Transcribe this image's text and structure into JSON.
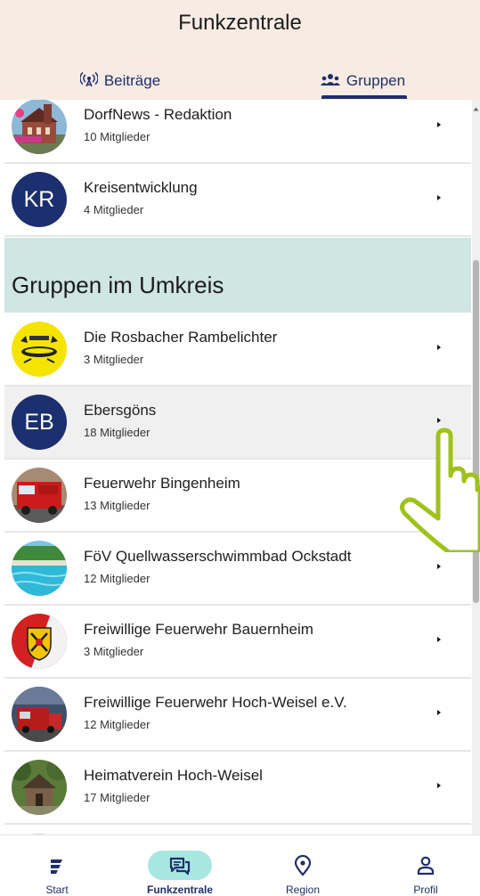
{
  "header": {
    "title": "Funkzentrale",
    "tabs": [
      {
        "label": "Beiträge",
        "icon": "broadcast-icon"
      },
      {
        "label": "Gruppen",
        "icon": "people-icon",
        "selected": true
      }
    ]
  },
  "my_groups": [
    {
      "name": "DorfNews - Redaktion",
      "members": "10 Mitglieder",
      "avatar": "church-photo"
    },
    {
      "name": "Kreisentwicklung",
      "members": "4 Mitglieder",
      "initials": "KR"
    }
  ],
  "nearby": {
    "title": "Gruppen im Umkreis",
    "groups": [
      {
        "name": "Die Rosbacher Rambelichter",
        "members": "3 Mitglieder",
        "avatar": "yellow-logo"
      },
      {
        "name": "Ebersgöns",
        "members": "18 Mitglieder",
        "initials": "EB",
        "highlighted": true
      },
      {
        "name": "Feuerwehr Bingenheim",
        "members": "13 Mitglieder",
        "avatar": "fire-truck-photo"
      },
      {
        "name": "FöV Quellwasserschwimmbad Ockstadt",
        "members": "12 Mitglieder",
        "avatar": "pool-photo"
      },
      {
        "name": "Freiwillige Feuerwehr Bauernheim",
        "members": "3 Mitglieder",
        "avatar": "fire-crest-logo"
      },
      {
        "name": "Freiwillige Feuerwehr Hoch-Weisel e.V.",
        "members": "12 Mitglieder",
        "avatar": "fire-station-photo"
      },
      {
        "name": "Heimatverein Hoch-Weisel",
        "members": "17 Mitglieder",
        "avatar": "hut-photo"
      }
    ]
  },
  "bottom_nav": [
    {
      "label": "Start",
      "icon": "start-icon"
    },
    {
      "label": "Funkzentrale",
      "icon": "chat-icon",
      "active": true
    },
    {
      "label": "Region",
      "icon": "location-pin-icon"
    },
    {
      "label": "Profil",
      "icon": "person-icon"
    }
  ],
  "colors": {
    "header_bg": "#f7ebe3",
    "accent_navy": "#1f2f6a",
    "section_bg": "#cfe6e2",
    "active_nav_pill": "#a8e6e1",
    "pointer_hand": "#9ec21a"
  }
}
